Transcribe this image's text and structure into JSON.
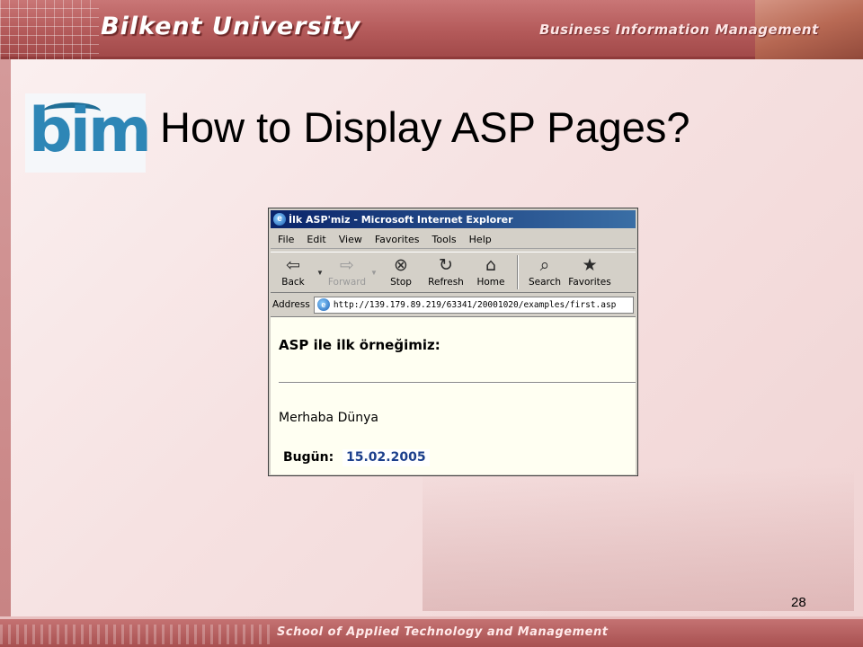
{
  "slide": {
    "university": "Bilkent University",
    "department": "Business Information Management",
    "logo_text": "bim",
    "title": "How to Display ASP Pages?",
    "school": "School of Applied Technology and Management",
    "page_number": "28"
  },
  "browser": {
    "window_title": "İlk ASP'miz - Microsoft Internet Explorer",
    "menu": [
      "File",
      "Edit",
      "View",
      "Favorites",
      "Tools",
      "Help"
    ],
    "toolbar": {
      "back": {
        "label": "Back",
        "icon": "back-arrow-icon"
      },
      "forward": {
        "label": "Forward",
        "icon": "forward-arrow-icon"
      },
      "stop": {
        "label": "Stop",
        "icon": "stop-icon"
      },
      "refresh": {
        "label": "Refresh",
        "icon": "refresh-icon"
      },
      "home": {
        "label": "Home",
        "icon": "home-icon"
      },
      "search": {
        "label": "Search",
        "icon": "search-icon"
      },
      "favorites": {
        "label": "Favorites",
        "icon": "favorites-icon"
      }
    },
    "address_label": "Address",
    "url": "http://139.179.89.219/63341/20001020/examples/first.asp",
    "page": {
      "heading": "ASP ile ilk örneğimiz:",
      "greeting": "Merhaba Dünya",
      "today_label": "Bugün:",
      "today_value": "15.02.2005"
    }
  },
  "colors": {
    "banner": "#b45a5a",
    "slide_background": "#f6e2e2",
    "ie_titlebar": "#0a246a",
    "date_text": "#1c3f8c"
  }
}
